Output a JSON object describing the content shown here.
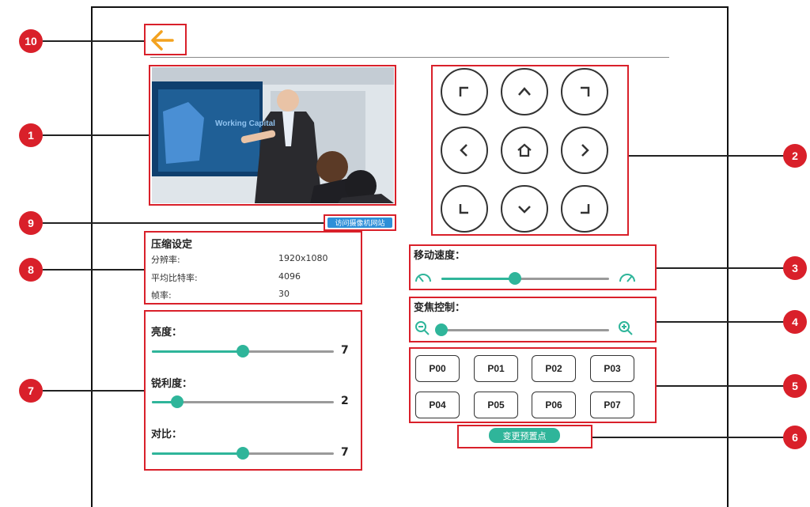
{
  "callouts": [
    "1",
    "2",
    "3",
    "4",
    "5",
    "6",
    "7",
    "8",
    "9",
    "10"
  ],
  "video": {
    "screen_text": "Working Capital"
  },
  "visit_camera_button": "访问摄像机网站",
  "compression": {
    "title": "压缩设定",
    "rows": [
      {
        "label": "分辨率:",
        "value": "1920x1080"
      },
      {
        "label": "平均比特率:",
        "value": "4096"
      },
      {
        "label": "帧率:",
        "value": "30"
      }
    ]
  },
  "image_settings": {
    "brightness": {
      "label": "亮度：",
      "value": "7",
      "level": 0.5
    },
    "sharpness": {
      "label": "锐利度：",
      "value": "2",
      "level": 0.14
    },
    "contrast": {
      "label": "对比：",
      "value": "7",
      "level": 0.5
    }
  },
  "move_speed": {
    "label": "移动速度：",
    "level": 0.44
  },
  "zoom_control": {
    "label": "变焦控制：",
    "level": 0.0
  },
  "presets": [
    "P00",
    "P01",
    "P02",
    "P03",
    "P04",
    "P05",
    "P06",
    "P07"
  ],
  "change_preset_button": "变更预置点",
  "colors": {
    "accent": "#2fb59a",
    "callout": "#d9202a",
    "back_arrow": "#f3a21f"
  }
}
